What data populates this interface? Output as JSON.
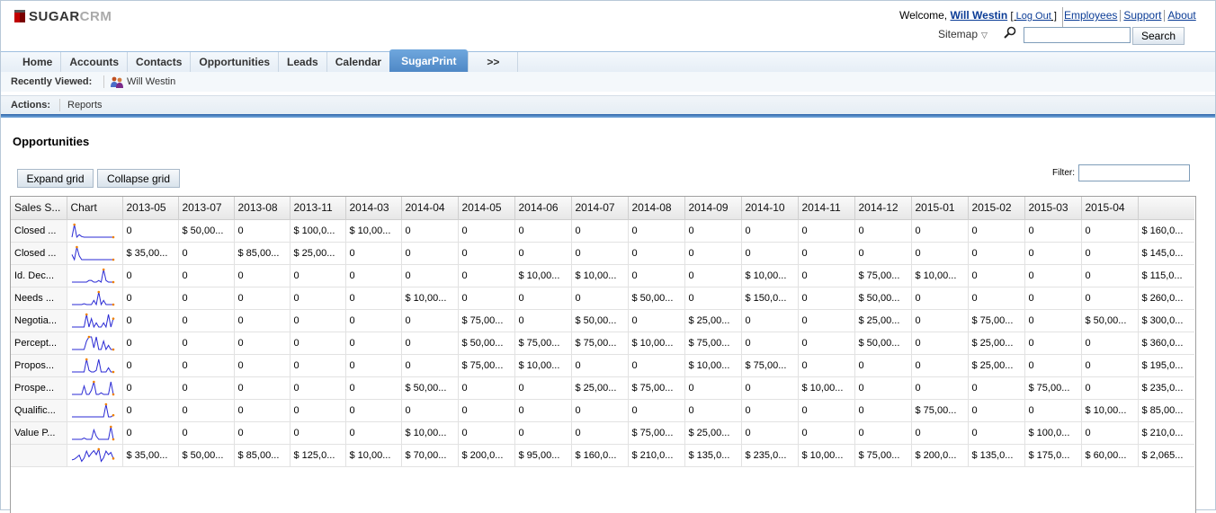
{
  "header": {
    "logo_bold": "SUGAR",
    "logo_light": "CRM",
    "welcome_prefix": "Welcome,",
    "user_name": "Will Westin",
    "logout_label": "Log Out",
    "links": [
      "Employees",
      "Support",
      "About"
    ],
    "sitemap_label": "Sitemap",
    "search_placeholder": "",
    "search_value": "",
    "search_button": "Search"
  },
  "nav": {
    "tabs": [
      "Home",
      "Accounts",
      "Contacts",
      "Opportunities",
      "Leads",
      "Calendar",
      "SugarPrint"
    ],
    "active_tab": "SugarPrint",
    "more_label": ">>"
  },
  "recent": {
    "label": "Recently Viewed:",
    "items": [
      "Will Westin"
    ]
  },
  "actions": {
    "label": "Actions:",
    "items": [
      "Reports"
    ]
  },
  "page": {
    "title": "Opportunities",
    "expand_label": "Expand grid",
    "collapse_label": "Collapse grid",
    "filter_label": "Filter:",
    "filter_value": ""
  },
  "grid": {
    "headers": [
      "Sales S...",
      "Chart",
      "2013-05",
      "2013-07",
      "2013-08",
      "2013-11",
      "2014-03",
      "2014-04",
      "2014-05",
      "2014-06",
      "2014-07",
      "2014-08",
      "2014-09",
      "2014-10",
      "2014-11",
      "2014-12",
      "2015-01",
      "2015-02",
      "2015-03",
      "2015-04",
      ""
    ],
    "rows": [
      {
        "name": "Closed ...",
        "cells": [
          "0",
          "$ 50,00...",
          "0",
          "$ 100,0...",
          "$ 10,00...",
          "0",
          "0",
          "0",
          "0",
          "0",
          "0",
          "0",
          "0",
          "0",
          "0",
          "0",
          "0",
          "0",
          "$ 160,0..."
        ],
        "spark": [
          0,
          1,
          0,
          0.2,
          0.05,
          0,
          0,
          0,
          0,
          0,
          0,
          0,
          0,
          0,
          0,
          0,
          0,
          0
        ]
      },
      {
        "name": "Closed ...",
        "cells": [
          "$ 35,00...",
          "0",
          "$ 85,00...",
          "$ 25,00...",
          "0",
          "0",
          "0",
          "0",
          "0",
          "0",
          "0",
          "0",
          "0",
          "0",
          "0",
          "0",
          "0",
          "0",
          "$ 145,0..."
        ],
        "spark": [
          0.4,
          0,
          1,
          0.3,
          0,
          0,
          0,
          0,
          0,
          0,
          0,
          0,
          0,
          0,
          0,
          0,
          0,
          0
        ]
      },
      {
        "name": "Id. Dec...",
        "cells": [
          "0",
          "0",
          "0",
          "0",
          "0",
          "0",
          "0",
          "$ 10,00...",
          "$ 10,00...",
          "0",
          "0",
          "$ 10,00...",
          "0",
          "$ 75,00...",
          "$ 10,00...",
          "0",
          "0",
          "0",
          "$ 115,0..."
        ],
        "spark": [
          0,
          0,
          0,
          0,
          0,
          0,
          0,
          0.13,
          0.13,
          0,
          0,
          0.13,
          0,
          1,
          0.13,
          0,
          0,
          0
        ]
      },
      {
        "name": "Needs ...",
        "cells": [
          "0",
          "0",
          "0",
          "0",
          "0",
          "$ 10,00...",
          "0",
          "0",
          "0",
          "$ 50,00...",
          "0",
          "$ 150,0...",
          "0",
          "$ 50,00...",
          "0",
          "0",
          "0",
          "0",
          "$ 260,0..."
        ],
        "spark": [
          0,
          0,
          0,
          0,
          0,
          0.07,
          0,
          0,
          0,
          0.33,
          0,
          1,
          0,
          0.33,
          0,
          0,
          0,
          0
        ]
      },
      {
        "name": "Negotia...",
        "cells": [
          "0",
          "0",
          "0",
          "0",
          "0",
          "0",
          "$ 75,00...",
          "0",
          "$ 50,00...",
          "0",
          "$ 25,00...",
          "0",
          "0",
          "$ 25,00...",
          "0",
          "$ 75,00...",
          "0",
          "$ 50,00...",
          "$ 300,0..."
        ],
        "spark": [
          0,
          0,
          0,
          0,
          0,
          0,
          1,
          0,
          0.67,
          0,
          0.33,
          0,
          0,
          0.33,
          0,
          1,
          0,
          0.67
        ]
      },
      {
        "name": "Percept...",
        "cells": [
          "0",
          "0",
          "0",
          "0",
          "0",
          "0",
          "$ 50,00...",
          "$ 75,00...",
          "$ 75,00...",
          "$ 10,00...",
          "$ 75,00...",
          "0",
          "0",
          "$ 50,00...",
          "0",
          "$ 25,00...",
          "0",
          "0",
          "$ 360,0..."
        ],
        "spark": [
          0,
          0,
          0,
          0,
          0,
          0,
          0.67,
          1,
          1,
          0.13,
          1,
          0,
          0,
          0.67,
          0,
          0.33,
          0,
          0
        ]
      },
      {
        "name": "Propos...",
        "cells": [
          "0",
          "0",
          "0",
          "0",
          "0",
          "0",
          "$ 75,00...",
          "$ 10,00...",
          "0",
          "0",
          "$ 10,00...",
          "$ 75,00...",
          "0",
          "0",
          "0",
          "$ 25,00...",
          "0",
          "0",
          "$ 195,0..."
        ],
        "spark": [
          0,
          0,
          0,
          0,
          0,
          0,
          1,
          0.13,
          0,
          0,
          0.13,
          1,
          0,
          0,
          0,
          0.33,
          0,
          0
        ]
      },
      {
        "name": "Prospe...",
        "cells": [
          "0",
          "0",
          "0",
          "0",
          "0",
          "$ 50,00...",
          "0",
          "0",
          "$ 25,00...",
          "$ 75,00...",
          "0",
          "0",
          "$ 10,00...",
          "0",
          "0",
          "0",
          "$ 75,00...",
          "0",
          "$ 235,0..."
        ],
        "spark": [
          0,
          0,
          0,
          0,
          0,
          0.67,
          0,
          0,
          0.33,
          1,
          0,
          0,
          0.13,
          0,
          0,
          0,
          1,
          0
        ]
      },
      {
        "name": "Qualific...",
        "cells": [
          "0",
          "0",
          "0",
          "0",
          "0",
          "0",
          "0",
          "0",
          "0",
          "0",
          "0",
          "0",
          "0",
          "0",
          "$ 75,00...",
          "0",
          "0",
          "$ 10,00...",
          "$ 85,00..."
        ],
        "spark": [
          0,
          0,
          0,
          0,
          0,
          0,
          0,
          0,
          0,
          0,
          0,
          0,
          0,
          0,
          1,
          0,
          0,
          0.13
        ]
      },
      {
        "name": "Value P...",
        "cells": [
          "0",
          "0",
          "0",
          "0",
          "0",
          "$ 10,00...",
          "0",
          "0",
          "0",
          "$ 75,00...",
          "$ 25,00...",
          "0",
          "0",
          "0",
          "0",
          "0",
          "$ 100,0...",
          "0",
          "$ 210,0..."
        ],
        "spark": [
          0,
          0,
          0,
          0,
          0,
          0.1,
          0,
          0,
          0,
          0.75,
          0.25,
          0,
          0,
          0,
          0,
          0,
          1,
          0
        ]
      }
    ],
    "total": {
      "name": "",
      "cells": [
        "$ 35,00...",
        "$ 50,00...",
        "$ 85,00...",
        "$ 125,0...",
        "$ 10,00...",
        "$ 70,00...",
        "$ 200,0...",
        "$ 95,00...",
        "$ 160,0...",
        "$ 210,0...",
        "$ 135,0...",
        "$ 235,0...",
        "$ 10,00...",
        "$ 75,00...",
        "$ 200,0...",
        "$ 135,0...",
        "$ 175,0...",
        "$ 60,00...",
        "$ 2,065..."
      ],
      "spark": [
        0.15,
        0.21,
        0.36,
        0.53,
        0.04,
        0.3,
        0.85,
        0.4,
        0.68,
        0.89,
        0.57,
        1,
        0.04,
        0.32,
        0.85,
        0.57,
        0.74,
        0.26
      ]
    },
    "spark_color": "#2a2ad4",
    "spark_mark_color": "#f08000"
  }
}
